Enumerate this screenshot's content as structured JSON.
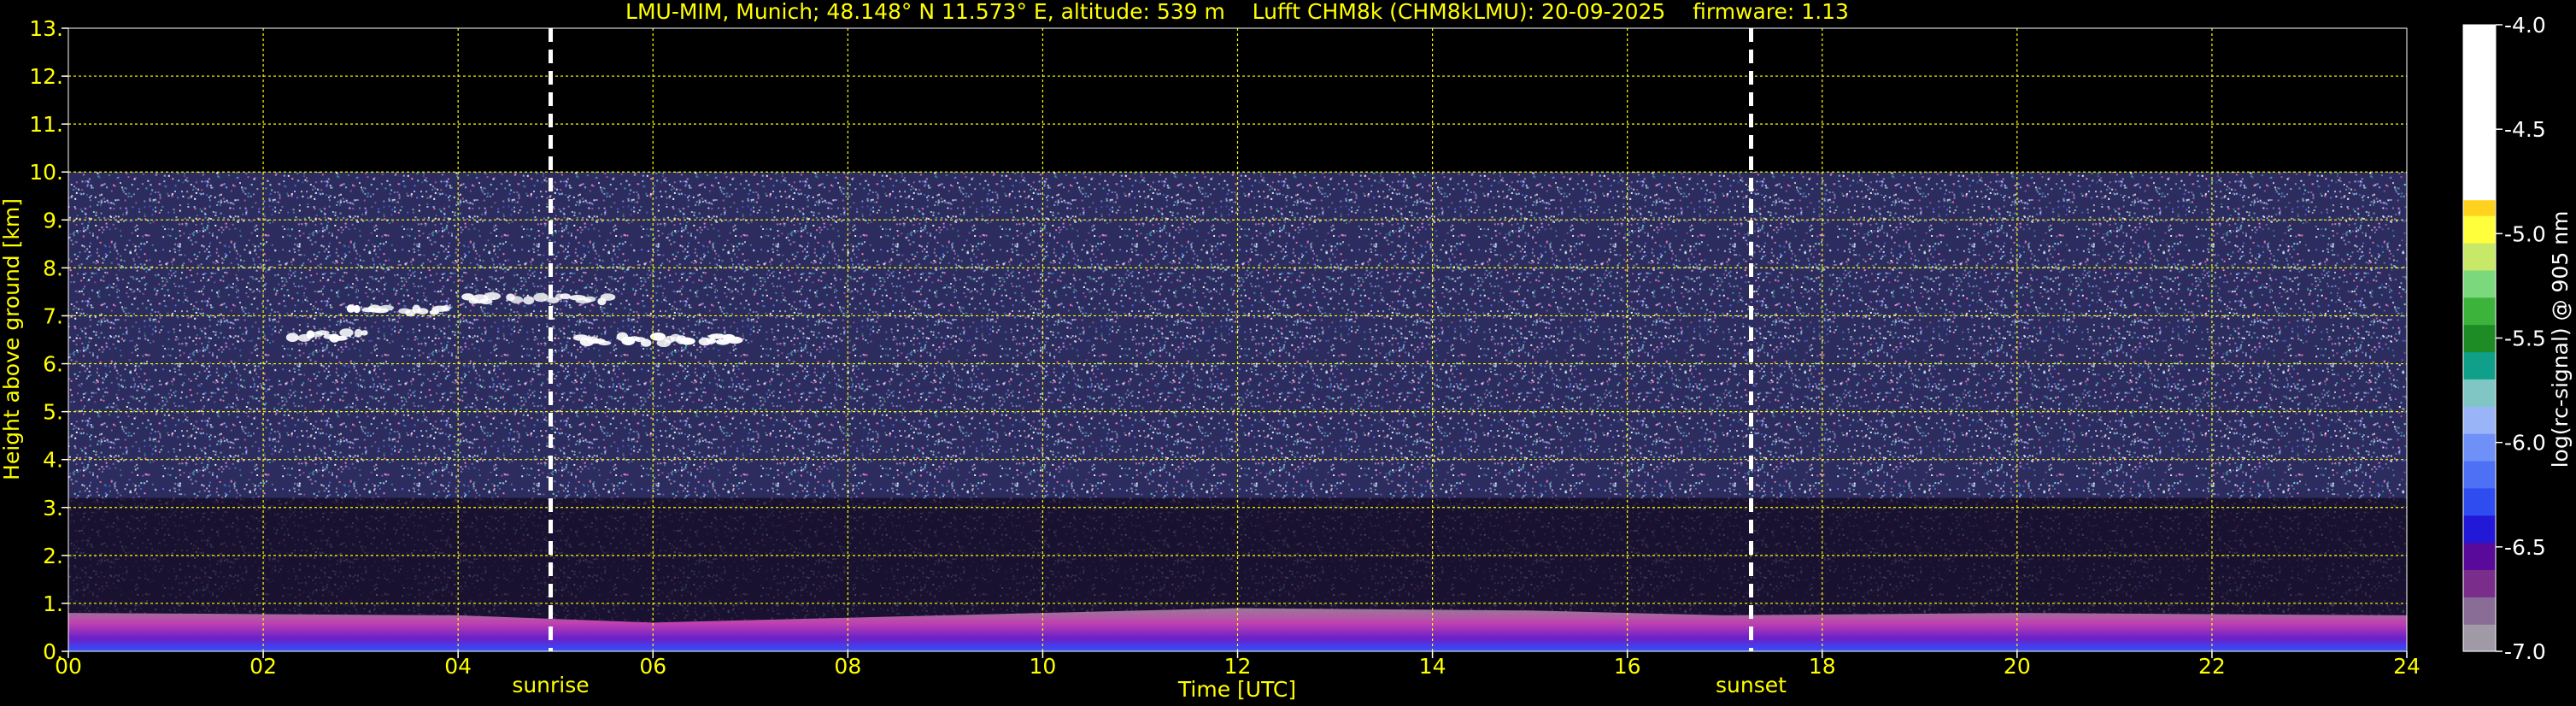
{
  "chart_data": {
    "type": "heatmap",
    "title": "LMU-MIM, Munich; 48.148° N 11.573° E, altitude: 539 m    Lufft CHM8k (CHM8kLMU): 20-09-2025    firmware: 1.13",
    "xlabel": "Time [UTC]",
    "ylabel": "Height above ground [km]",
    "xlim": [
      0,
      24
    ],
    "ylim": [
      0,
      13
    ],
    "x_ticks": [
      "00",
      "02",
      "04",
      "06",
      "08",
      "10",
      "12",
      "14",
      "16",
      "18",
      "20",
      "22",
      "24"
    ],
    "y_ticks": [
      "0.",
      "1.",
      "2.",
      "3.",
      "4.",
      "5.",
      "6.",
      "7.",
      "8.",
      "9.",
      "10.",
      "11.",
      "12.",
      "13."
    ],
    "grid": true,
    "data_top_km": 10,
    "markers": [
      {
        "label": "sunrise",
        "time": 4.95
      },
      {
        "label": "sunset",
        "time": 17.27
      }
    ],
    "cloud_layers": [
      {
        "t_start": 2.3,
        "t_end": 3.1,
        "height_km": 6.6
      },
      {
        "t_start": 2.9,
        "t_end": 4.0,
        "height_km": 7.1
      },
      {
        "t_start": 4.1,
        "t_end": 5.6,
        "height_km": 7.35
      },
      {
        "t_start": 5.2,
        "t_end": 6.9,
        "height_km": 6.5
      }
    ],
    "boundary_layer": [
      {
        "time": 0,
        "top_km": 0.8
      },
      {
        "time": 4,
        "top_km": 0.75
      },
      {
        "time": 6,
        "top_km": 0.6
      },
      {
        "time": 9,
        "top_km": 0.75
      },
      {
        "time": 12,
        "top_km": 0.9
      },
      {
        "time": 15,
        "top_km": 0.85
      },
      {
        "time": 17,
        "top_km": 0.75
      },
      {
        "time": 20,
        "top_km": 0.8
      },
      {
        "time": 24,
        "top_km": 0.75
      }
    ],
    "colorbar": {
      "label": "log(rc-signal) @ 905 nm",
      "range": [
        -7.0,
        -4.0
      ],
      "ticks": [
        "-4.0",
        "-4.5",
        "-5.0",
        "-5.5",
        "-6.0",
        "-6.5",
        "-7.0"
      ],
      "colors": [
        "#a09aa6",
        "#8a6d96",
        "#7b2d8c",
        "#5a0a9a",
        "#2218d8",
        "#2e4cf0",
        "#4d70f4",
        "#6f90f6",
        "#9ab4f8",
        "#7fc6c4",
        "#10a08a",
        "#1d8c24",
        "#3cb43c",
        "#7cd87c",
        "#c8e868",
        "#ffff3c",
        "#ffd21e",
        "#ff9a10",
        "#ff5a10",
        "#f01010",
        "#e8a8a8",
        "#f0dcdc",
        "#ffffff"
      ]
    },
    "colors": {
      "text": "#ffff00",
      "grid": "#ffff00",
      "background": "#000000",
      "marker_line": "#ffffff"
    }
  }
}
